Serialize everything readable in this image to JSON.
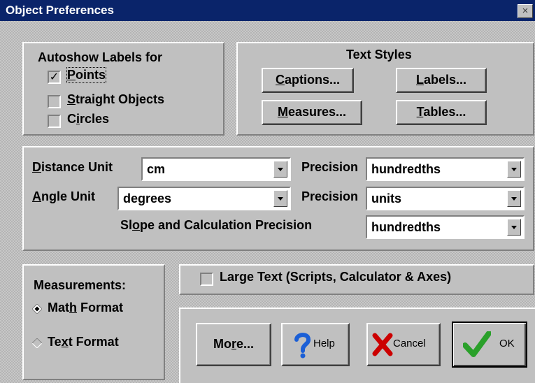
{
  "window": {
    "title": "Object Preferences",
    "close_glyph": "×"
  },
  "autoshow": {
    "heading": "Autoshow Labels for",
    "items": [
      {
        "pre": "",
        "acc": "P",
        "post": "oints",
        "checked": true
      },
      {
        "pre": "",
        "acc": "S",
        "post": "traight Objects",
        "checked": false
      },
      {
        "pre": "C",
        "acc": "i",
        "post": "rcles",
        "checked": false
      }
    ]
  },
  "text_styles": {
    "heading": "Text Styles",
    "captions": {
      "acc": "C",
      "post": "aptions..."
    },
    "labels": {
      "acc": "L",
      "post": "abels..."
    },
    "measures": {
      "acc": "M",
      "post": "easures..."
    },
    "tables": {
      "acc": "T",
      "post": "ables..."
    }
  },
  "units": {
    "distance_label": {
      "acc": "D",
      "post": "istance Unit"
    },
    "distance_value": "cm",
    "distance_precision_label": "Precision",
    "distance_precision_value": "hundredths",
    "angle_label": {
      "acc": "A",
      "post": "ngle Unit"
    },
    "angle_value": "degrees",
    "angle_precision_label": "Precision",
    "angle_precision_value": "units",
    "slope_label": {
      "pre": "Sl",
      "acc": "o",
      "post": "pe and Calculation Precision"
    },
    "slope_value": "hundredths"
  },
  "measurements": {
    "heading": "Measurements:",
    "math": {
      "pre": "Mat",
      "acc": "h",
      "post": " Format",
      "selected": true
    },
    "text": {
      "pre": "Te",
      "acc": "x",
      "post": "t Format",
      "selected": false
    }
  },
  "large_text": {
    "label": "Large Text (Scripts, Calculator & Axes)",
    "checked": false
  },
  "buttons": {
    "more": {
      "pre": "Mo",
      "acc": "r",
      "post": "e..."
    },
    "help": "Help",
    "cancel": "Cancel",
    "ok": "OK"
  },
  "colors": {
    "title_bg": "#0a246a",
    "face": "#c0c0c0",
    "ok_check": "#2aa02a",
    "cancel_x": "#cc0000",
    "help_q": "#1b5fd6"
  }
}
